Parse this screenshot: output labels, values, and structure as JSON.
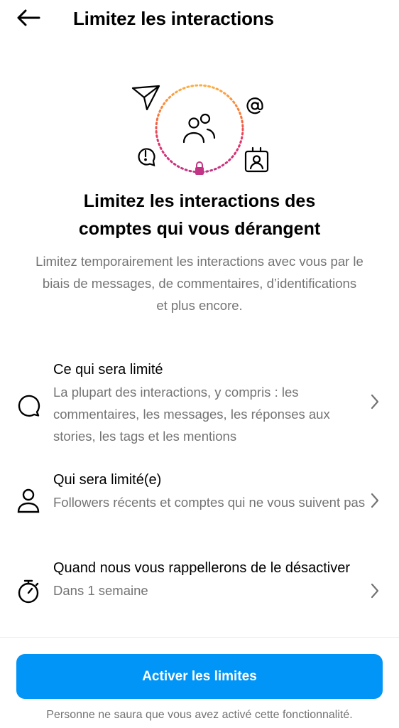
{
  "header": {
    "title": "Limitez les interactions",
    "back_icon": "arrow-left-icon"
  },
  "hero": {
    "icons": [
      "send-icon",
      "at-sign-icon",
      "alert-bubble-icon",
      "contact-card-icon",
      "users-icon",
      "lock-icon"
    ],
    "ring_colors": [
      "#fcaf45",
      "#f77737",
      "#e1306c",
      "#c13584",
      "#833ab4"
    ]
  },
  "main": {
    "headline_lines": [
      "Limitez les interactions des",
      "comptes qui vous dérangent"
    ],
    "description": "Limitez temporairement les interactions avec vous par le biais de messages, de commentaires, d’identifications et plus encore."
  },
  "options": [
    {
      "icon": "comment-icon",
      "title": "Ce qui sera limité",
      "description": "La plupart des interactions, y compris : les commentaires, les messages, les réponses aux stories, les tags et les mentions"
    },
    {
      "icon": "person-icon",
      "title": "Qui sera limité(e)",
      "description": "Followers récents et comptes qui ne vous suivent pas"
    },
    {
      "icon": "stopwatch-icon",
      "title": "Quand nous vous rappellerons de le désactiver",
      "description": "Dans 1 semaine"
    }
  ],
  "footer": {
    "button_label": "Activer les limites",
    "note": "Personne ne saura que vous avez activé cette fonctionnalité."
  },
  "colors": {
    "primary": "#0095f6",
    "secondary_text": "#737373"
  }
}
